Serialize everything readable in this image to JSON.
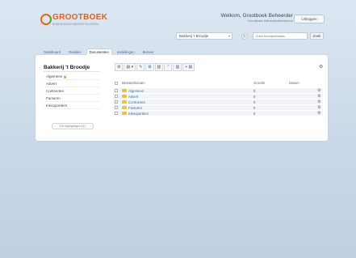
{
  "header": {
    "logo_name": "GROOTBOEK",
    "logo_tagline": "BOEKHOUDEN BEDRIJFSLIJSTEN",
    "welcome_title": "Welkom, Grootboek Beheerder",
    "welcome_sub": "Grootboek Administratiekantoor",
    "logout_label": "Uitloggen",
    "bakery_select_value": "Bakkerij 't Broodje",
    "search_placeholder": "Zoek bedrijfsrelaties",
    "search_button": "Zoek"
  },
  "tabs": [
    {
      "label": "Dashboard",
      "active": false
    },
    {
      "label": "Relaties",
      "active": false
    },
    {
      "label": "Documenten",
      "active": true
    },
    {
      "label": "Instellingen",
      "active": false
    },
    {
      "label": "Beheer",
      "active": false
    }
  ],
  "sidebar": {
    "title": "Bakkerij 't Broodje",
    "items": [
      {
        "label": "Algemeen",
        "locked": true
      },
      {
        "label": "Advert",
        "locked": false
      },
      {
        "label": "Contracten",
        "locked": false
      },
      {
        "label": "Facturen",
        "locked": false
      },
      {
        "label": "Inkooporders",
        "locked": false
      }
    ],
    "new_list_button": "De wijzigingen (1)"
  },
  "toolbar": {
    "buttons": [
      "⚙",
      "▤ ▾",
      "✎",
      "⊞",
      "▥",
      "⌃",
      "▥",
      "+ ▤"
    ]
  },
  "table": {
    "headers": {
      "name": "Bestandsnaam",
      "size": "Grootte",
      "date": "Datum"
    },
    "rows": [
      {
        "name": "Algemeen",
        "count": "0"
      },
      {
        "name": "Advert",
        "count": "0"
      },
      {
        "name": "Contracten",
        "count": "0"
      },
      {
        "name": "Facturen",
        "count": "0"
      },
      {
        "name": "Inkooporders",
        "count": "0"
      }
    ]
  },
  "colors": {
    "brand_orange": "#e0601a",
    "brand_green": "#56a42d",
    "link_blue": "#2f6db0",
    "background": "#c8d7e8"
  },
  "icons": {
    "logo": "grootboek-logo-icon",
    "lock": "lock-icon",
    "folder": "folder-icon",
    "gear": "gear-icon"
  }
}
